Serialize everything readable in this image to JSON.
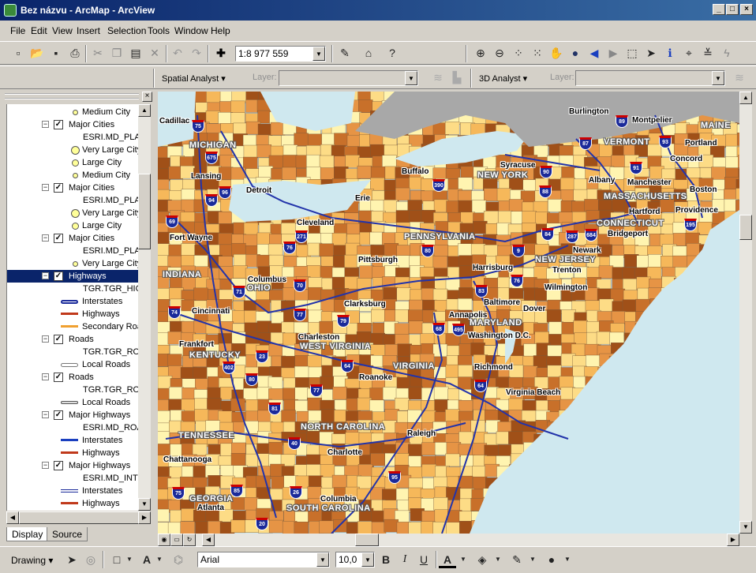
{
  "window": {
    "title": "Bez názvu - ArcMap - ArcView",
    "min": "_",
    "max": "□",
    "close": "×"
  },
  "menu": [
    "File",
    "Edit",
    "View",
    "Insert",
    "Selection",
    "Tools",
    "Window",
    "Help"
  ],
  "toolbar": {
    "scale": "1:8 977 559"
  },
  "analyst": {
    "spatial": "Spatial Analyst ▾",
    "layer1": "Layer:",
    "three_d": "3D Analyst ▾",
    "layer2": "Layer:"
  },
  "toc": [
    {
      "type": "sym",
      "sym": "dot-s",
      "label": "Medium City"
    },
    {
      "type": "layer",
      "label": "Major Cities"
    },
    {
      "type": "src",
      "label": "ESRI.MD_PLAC"
    },
    {
      "type": "sym",
      "sym": "dot-l",
      "label": "Very Large City"
    },
    {
      "type": "sym",
      "sym": "dot-m",
      "label": "Large City"
    },
    {
      "type": "sym",
      "sym": "dot-s",
      "label": "Medium City"
    },
    {
      "type": "layer",
      "label": "Major Cities"
    },
    {
      "type": "src",
      "label": "ESRI.MD_PLAC"
    },
    {
      "type": "sym",
      "sym": "dot-l",
      "label": "Very Large City"
    },
    {
      "type": "sym",
      "sym": "dot-m",
      "label": "Large City"
    },
    {
      "type": "layer",
      "label": "Major Cities"
    },
    {
      "type": "src",
      "label": "ESRI.MD_PLAC"
    },
    {
      "type": "sym",
      "sym": "dot-s",
      "label": "Very Large City"
    },
    {
      "type": "layer",
      "label": "Highways",
      "selected": true
    },
    {
      "type": "src",
      "label": "TGR.TGR_HIG"
    },
    {
      "type": "sym",
      "sym": "line-double",
      "label": "Interstates"
    },
    {
      "type": "sym",
      "sym": "line-red",
      "label": "Highways"
    },
    {
      "type": "sym",
      "sym": "line-orange",
      "label": "Secondary Roads"
    },
    {
      "type": "layer",
      "label": "Roads"
    },
    {
      "type": "src",
      "label": "TGR.TGR_ROA"
    },
    {
      "type": "sym",
      "sym": "line-hollow",
      "label": "Local Roads"
    },
    {
      "type": "layer",
      "label": "Roads"
    },
    {
      "type": "src",
      "label": "TGR.TGR_ROA"
    },
    {
      "type": "sym",
      "sym": "line-grey",
      "label": "Local Roads"
    },
    {
      "type": "layer",
      "label": "Major Highways"
    },
    {
      "type": "src",
      "label": "ESRI.MD_ROA"
    },
    {
      "type": "sym",
      "sym": "line-blue",
      "label": "Interstates"
    },
    {
      "type": "sym",
      "sym": "line-red",
      "label": "Highways"
    },
    {
      "type": "layer",
      "label": "Major Highways"
    },
    {
      "type": "src",
      "label": "ESRI.MD_INTI"
    },
    {
      "type": "sym",
      "sym": "line-dblue",
      "label": "Interstates"
    },
    {
      "type": "sym",
      "sym": "line-red",
      "label": "Highways"
    }
  ],
  "tabs": {
    "display": "Display",
    "source": "Source"
  },
  "map": {
    "states": [
      "MICHIGAN",
      "NEW YORK",
      "VERMONT",
      "MAINE",
      "MASSACHUSETTS",
      "CONNECTICUT",
      "PENNSYLVANIA",
      "NEW JERSEY",
      "INDIANA",
      "OHIO",
      "MARYLAND",
      "WEST VIRGINIA",
      "KENTUCKY",
      "VIRGINIA",
      "NORTH CAROLINA",
      "TENNESSEE",
      "GEORGIA",
      "SOUTH CAROLINA"
    ],
    "cities": [
      "Cadillac",
      "Burlington",
      "Montpelier",
      "Portland",
      "Lansing",
      "Detroit",
      "Buffalo",
      "Syracuse",
      "Albany",
      "Concord",
      "Manchester",
      "Boston",
      "Erie",
      "Hartford",
      "Providence",
      "Cleveland",
      "Bridgeport",
      "Fort Wayne",
      "Pittsburgh",
      "Newark",
      "Trenton",
      "Columbus",
      "Harrisburg",
      "Wilmington",
      "Clarksburg",
      "Baltimore",
      "Dover",
      "Cincinnati",
      "Annapolis",
      "Washington D.C.",
      "Frankfort",
      "Charleston",
      "Richmond",
      "Roanoke",
      "Virginia Beach",
      "Raleigh",
      "Charlotte",
      "Chattanooga",
      "Columbia",
      "Atlanta"
    ],
    "shields": [
      "75",
      "89",
      "93",
      "675",
      "91",
      "87",
      "96",
      "90",
      "94",
      "390",
      "88",
      "69",
      "271",
      "84",
      "287",
      "684",
      "195",
      "76",
      "80",
      "9",
      "70",
      "71",
      "83",
      "76",
      "74",
      "77",
      "79",
      "68",
      "495",
      "64",
      "402",
      "23",
      "80",
      "64",
      "81",
      "77",
      "40",
      "95",
      "85",
      "26",
      "75",
      "20"
    ]
  },
  "drawbar": {
    "drawing": "Drawing ▾",
    "font": "Arial",
    "size": "10,0",
    "bold": "B",
    "italic": "I",
    "underline": "U",
    "fontcolor": "A"
  }
}
